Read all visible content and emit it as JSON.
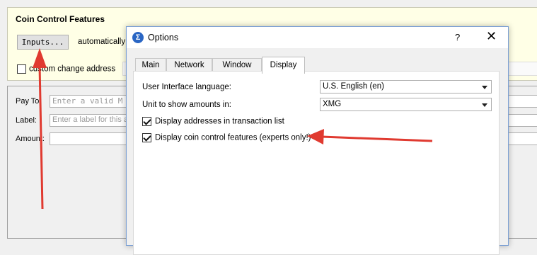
{
  "coin_control": {
    "title": "Coin Control Features",
    "inputs_button": "Inputs...",
    "auto_label": "automatically s",
    "custom_change_label": "custom change address",
    "custom_change_checked": false
  },
  "send": {
    "pay_to_label": "Pay To:",
    "pay_to_placeholder": "Enter a valid M",
    "label_label": "Label:",
    "label_placeholder": "Enter a label for this a",
    "amount_label": "Amount:"
  },
  "dialog": {
    "title": "Options",
    "app_icon": "Σ",
    "help": "?",
    "close": "✕",
    "tabs": [
      {
        "label": "Main",
        "active": false
      },
      {
        "label": "Network",
        "active": false
      },
      {
        "label": "Window",
        "active": false
      },
      {
        "label": "Display",
        "active": true
      }
    ],
    "display": {
      "ui_language_label": "User Interface language:",
      "ui_language_value": "U.S. English (en)",
      "unit_label": "Unit to show amounts in:",
      "unit_value": "XMG",
      "show_addresses_label": "Display addresses in transaction list",
      "show_addresses_checked": true,
      "coin_control_label": "Display coin control features (experts only!)",
      "coin_control_checked": true
    }
  },
  "annotation_color": "#e03a30"
}
